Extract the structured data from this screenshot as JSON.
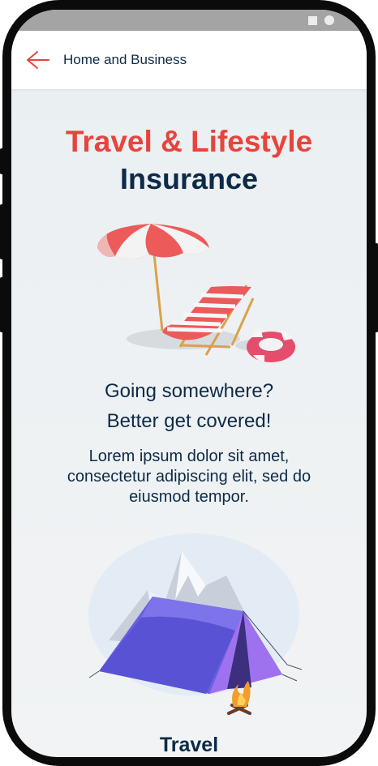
{
  "header": {
    "title": "Home and Business",
    "back_icon": "arrow-left-icon",
    "accent": "#e8443c"
  },
  "hero": {
    "title_line1": "Travel & Lifestyle",
    "title_line2": "Insurance",
    "title_line1_color": "#e8443c",
    "title_line2_color": "#0d2a47"
  },
  "tagline": {
    "line1": "Going somewhere?",
    "line2": "Better get covered!"
  },
  "description": "Lorem ipsum dolor sit amet, consectetur adipiscing elit, sed do eiusmod tempor.",
  "sections": [
    {
      "label": "Travel",
      "icon": "camping-tent-icon"
    }
  ],
  "illustrations": {
    "beach": "beach-umbrella-chair-icon",
    "camp": "camping-tent-icon"
  },
  "status_bar_icons": [
    "square-icon",
    "circle-icon"
  ]
}
